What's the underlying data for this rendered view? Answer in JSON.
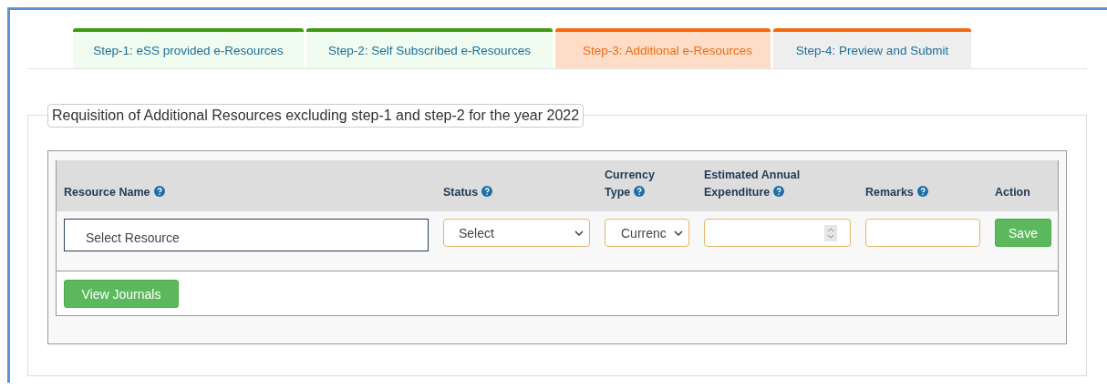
{
  "tabs": [
    {
      "label": "Step-1: eSS provided e-Resources",
      "kind": "complete",
      "selected": false
    },
    {
      "label": "Step-2: Self Subscribed e-Resources",
      "kind": "complete",
      "selected": false
    },
    {
      "label": "Step-3: Additional e-Resources",
      "kind": "pending",
      "selected": true
    },
    {
      "label": "Step-4: Preview and Submit",
      "kind": "pending",
      "selected": false
    }
  ],
  "section": {
    "legend": "Requisition of Additional Resources excluding step-1 and step-2 for the year 2022"
  },
  "table": {
    "columns": [
      {
        "label": "Resource Name",
        "help": true
      },
      {
        "label": "Status",
        "help": true
      },
      {
        "label": "Currency Type",
        "help": true
      },
      {
        "label": "Estimated Annual Expenditure",
        "help": true
      },
      {
        "label": "Remarks",
        "help": true
      },
      {
        "label": "Action",
        "help": false
      }
    ],
    "row": {
      "resource": {
        "value": "Select Resource"
      },
      "status": {
        "value": "Select"
      },
      "currency": {
        "value": "Currenc"
      },
      "save_button": "Save"
    }
  },
  "buttons": [
    "View Journals"
  ]
}
